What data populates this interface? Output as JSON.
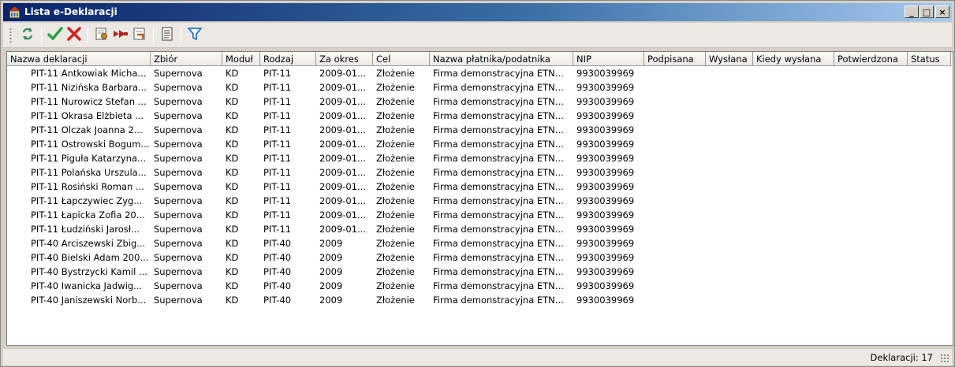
{
  "window": {
    "title": "Lista e-Deklaracji",
    "icon": "building-icon",
    "controls": [
      "_",
      "□",
      "×"
    ]
  },
  "toolbar": {
    "buttons": [
      {
        "name": "refresh-icon",
        "color": "#2e8b57"
      },
      {
        "name": "approve-icon",
        "color": "#2ea043"
      },
      {
        "name": "reject-icon",
        "color": "#d62020"
      },
      {
        "name": "sign-icon",
        "color": "#c08a2c"
      },
      {
        "name": "send-icon",
        "color": "#b22222"
      },
      {
        "name": "receive-upo-icon",
        "color": "#c06020"
      },
      {
        "name": "preview-icon",
        "color": "#3a3a3a"
      },
      {
        "name": "filter-icon",
        "color": "#1e78c8"
      }
    ]
  },
  "table": {
    "columns": [
      "Nazwa deklaracji",
      "Zbiór",
      "Moduł",
      "Rodzaj",
      "Za okres",
      "Cel",
      "Nazwa płatnika/podatnika",
      "NIP",
      "Podpisana",
      "Wysłana",
      "Kiedy wysłana",
      "Potwierdzona",
      "Status"
    ],
    "rows": [
      [
        "PIT-11 Antkowiak Micha...",
        "Supernova",
        "KD",
        "PIT-11",
        "2009-01...",
        "Złożenie",
        "Firma demonstracyjna ETN...",
        "9930039969",
        "",
        "",
        "",
        "",
        ""
      ],
      [
        "PIT-11 Nizińska Barbara...",
        "Supernova",
        "KD",
        "PIT-11",
        "2009-01...",
        "Złożenie",
        "Firma demonstracyjna ETN...",
        "9930039969",
        "",
        "",
        "",
        "",
        ""
      ],
      [
        "PIT-11 Nurowicz Stefan ...",
        "Supernova",
        "KD",
        "PIT-11",
        "2009-01...",
        "Złożenie",
        "Firma demonstracyjna ETN...",
        "9930039969",
        "",
        "",
        "",
        "",
        ""
      ],
      [
        "PIT-11 Okrasa Elżbieta ...",
        "Supernova",
        "KD",
        "PIT-11",
        "2009-01...",
        "Złożenie",
        "Firma demonstracyjna ETN...",
        "9930039969",
        "",
        "",
        "",
        "",
        ""
      ],
      [
        "PIT-11 Olczak Joanna 2...",
        "Supernova",
        "KD",
        "PIT-11",
        "2009-01...",
        "Złożenie",
        "Firma demonstracyjna ETN...",
        "9930039969",
        "",
        "",
        "",
        "",
        ""
      ],
      [
        "PIT-11 Ostrowski Bogum...",
        "Supernova",
        "KD",
        "PIT-11",
        "2009-01...",
        "Złożenie",
        "Firma demonstracyjna ETN...",
        "9930039969",
        "",
        "",
        "",
        "",
        ""
      ],
      [
        "PIT-11 Piguła Katarzyna...",
        "Supernova",
        "KD",
        "PIT-11",
        "2009-01...",
        "Złożenie",
        "Firma demonstracyjna ETN...",
        "9930039969",
        "",
        "",
        "",
        "",
        ""
      ],
      [
        "PIT-11 Polańska Urszula...",
        "Supernova",
        "KD",
        "PIT-11",
        "2009-01...",
        "Złożenie",
        "Firma demonstracyjna ETN...",
        "9930039969",
        "",
        "",
        "",
        "",
        ""
      ],
      [
        "PIT-11 Rosiński Roman ...",
        "Supernova",
        "KD",
        "PIT-11",
        "2009-01...",
        "Złożenie",
        "Firma demonstracyjna ETN...",
        "9930039969",
        "",
        "",
        "",
        "",
        ""
      ],
      [
        "PIT-11 Łapczywiec Zyg...",
        "Supernova",
        "KD",
        "PIT-11",
        "2009-01...",
        "Złożenie",
        "Firma demonstracyjna ETN...",
        "9930039969",
        "",
        "",
        "",
        "",
        ""
      ],
      [
        "PIT-11 Łapicka Zofia 20...",
        "Supernova",
        "KD",
        "PIT-11",
        "2009-01...",
        "Złożenie",
        "Firma demonstracyjna ETN...",
        "9930039969",
        "",
        "",
        "",
        "",
        ""
      ],
      [
        "PIT-11 Łudziński Jarosł...",
        "Supernova",
        "KD",
        "PIT-11",
        "2009-01...",
        "Złożenie",
        "Firma demonstracyjna ETN...",
        "9930039969",
        "",
        "",
        "",
        "",
        ""
      ],
      [
        "PIT-40 Arciszewski Zbig...",
        "Supernova",
        "KD",
        "PIT-40",
        "2009",
        "Złożenie",
        "Firma demonstracyjna ETN...",
        "9930039969",
        "",
        "",
        "",
        "",
        ""
      ],
      [
        "PIT-40 Bielski Adam 200...",
        "Supernova",
        "KD",
        "PIT-40",
        "2009",
        "Złożenie",
        "Firma demonstracyjna ETN...",
        "9930039969",
        "",
        "",
        "",
        "",
        ""
      ],
      [
        "PIT-40 Bystrzycki Kamil ...",
        "Supernova",
        "KD",
        "PIT-40",
        "2009",
        "Złożenie",
        "Firma demonstracyjna ETN...",
        "9930039969",
        "",
        "",
        "",
        "",
        ""
      ],
      [
        "PIT-40 Iwanicka Jadwig...",
        "Supernova",
        "KD",
        "PIT-40",
        "2009",
        "Złożenie",
        "Firma demonstracyjna ETN...",
        "9930039969",
        "",
        "",
        "",
        "",
        ""
      ],
      [
        "PIT-40 Janiszewski Norb...",
        "Supernova",
        "KD",
        "PIT-40",
        "2009",
        "Złożenie",
        "Firma demonstracyjna ETN...",
        "9930039969",
        "",
        "",
        "",
        "",
        ""
      ]
    ]
  },
  "statusbar": {
    "count_text": "Deklaracji: 17"
  }
}
